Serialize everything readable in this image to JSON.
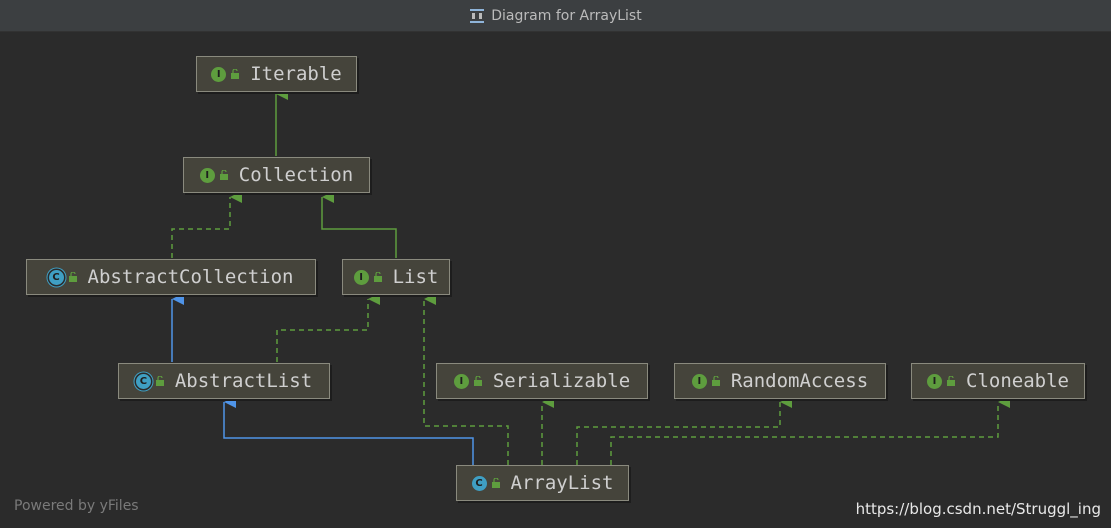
{
  "window": {
    "title": "Diagram for ArrayList"
  },
  "nodes": {
    "iterable": {
      "label": "Iterable",
      "kind": "interface",
      "badge": "I"
    },
    "collection": {
      "label": "Collection",
      "kind": "interface",
      "badge": "I"
    },
    "abstract_collection": {
      "label": "AbstractCollection",
      "kind": "abstract-class",
      "badge": "C"
    },
    "list": {
      "label": "List",
      "kind": "interface",
      "badge": "I"
    },
    "abstract_list": {
      "label": "AbstractList",
      "kind": "abstract-class",
      "badge": "C"
    },
    "serializable": {
      "label": "Serializable",
      "kind": "interface",
      "badge": "I"
    },
    "random_access": {
      "label": "RandomAccess",
      "kind": "interface",
      "badge": "I"
    },
    "cloneable": {
      "label": "Cloneable",
      "kind": "interface",
      "badge": "I"
    },
    "array_list": {
      "label": "ArrayList",
      "kind": "class",
      "badge": "C"
    }
  },
  "edges": [
    {
      "from": "collection",
      "to": "iterable",
      "type": "extends"
    },
    {
      "from": "abstract_collection",
      "to": "collection",
      "type": "implements"
    },
    {
      "from": "list",
      "to": "collection",
      "type": "extends"
    },
    {
      "from": "abstract_list",
      "to": "abstract_collection",
      "type": "extends-class"
    },
    {
      "from": "abstract_list",
      "to": "list",
      "type": "implements"
    },
    {
      "from": "array_list",
      "to": "abstract_list",
      "type": "extends-class"
    },
    {
      "from": "array_list",
      "to": "list",
      "type": "implements"
    },
    {
      "from": "array_list",
      "to": "serializable",
      "type": "implements"
    },
    {
      "from": "array_list",
      "to": "random_access",
      "type": "implements"
    },
    {
      "from": "array_list",
      "to": "cloneable",
      "type": "implements"
    }
  ],
  "colors": {
    "interface_edge": "#5e9d3e",
    "class_edge": "#4f94e8",
    "interface_badge": "#5e9d3e",
    "class_badge": "#3f9fc3",
    "node_fill": "#45443b",
    "background": "#2b2b2b"
  },
  "icons": {
    "title": "diagram-icon",
    "visibility": "unlock-icon"
  },
  "footer": {
    "powered_by": "Powered by yFiles",
    "watermark": "https://blog.csdn.net/Struggl_ing"
  }
}
